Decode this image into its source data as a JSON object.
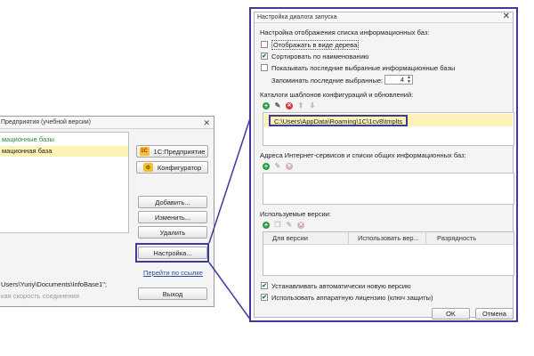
{
  "launcher": {
    "title": "Предприятия (учебной версии)",
    "group_name": "мационные базы",
    "selected_base": "мационная база",
    "buttons": {
      "enterprise": "1С:Предприятие",
      "configurator": "Конфигуратор",
      "add": "Добавить...",
      "edit": "Изменить...",
      "delete": "Удалить",
      "settings": "Настройка..."
    },
    "link": "Перейти по ссылке",
    "path": "Users\\Yuriy\\Documents\\InfoBase1\";",
    "speed": "кая скорость соединения",
    "exit": "Выход"
  },
  "dialog": {
    "title": "Настройка диалога запуска",
    "display_section": "Настройка отображения списка информационных баз:",
    "options": [
      {
        "label": "Отображать в виде дерева",
        "checked": false
      },
      {
        "label": "Сортировать по наименованию",
        "checked": true
      },
      {
        "label": "Показывать последние выбранные информационные базы",
        "checked": false
      }
    ],
    "remember_label": "Запоминать последние выбранные:",
    "remember_value": "4",
    "templates_section": "Каталоги шаблонов конфигураций и обновлений:",
    "templates_path": "C:\\Users\\AppData\\Roaming\\1C\\1cv8\\tmplts",
    "internet_section": "Адреса Интернет-сервисов и списки общих информационных баз:",
    "versions_section": "Используемые версии:",
    "versions_columns": [
      "Для версии",
      "Использовать вер...",
      "Разрядность"
    ],
    "auto_install": {
      "label": "Устанавливать автоматически новую версию",
      "checked": true
    },
    "hardware_license": {
      "label": "Использовать аппаратную лицензию (ключ защиты)",
      "checked": true
    },
    "ok": "OK",
    "cancel": "Отмена"
  },
  "colors": {
    "highlight_border": "#3d3a9a",
    "selected_row": "#fbf3b5",
    "group_text": "#2c8a3a"
  }
}
